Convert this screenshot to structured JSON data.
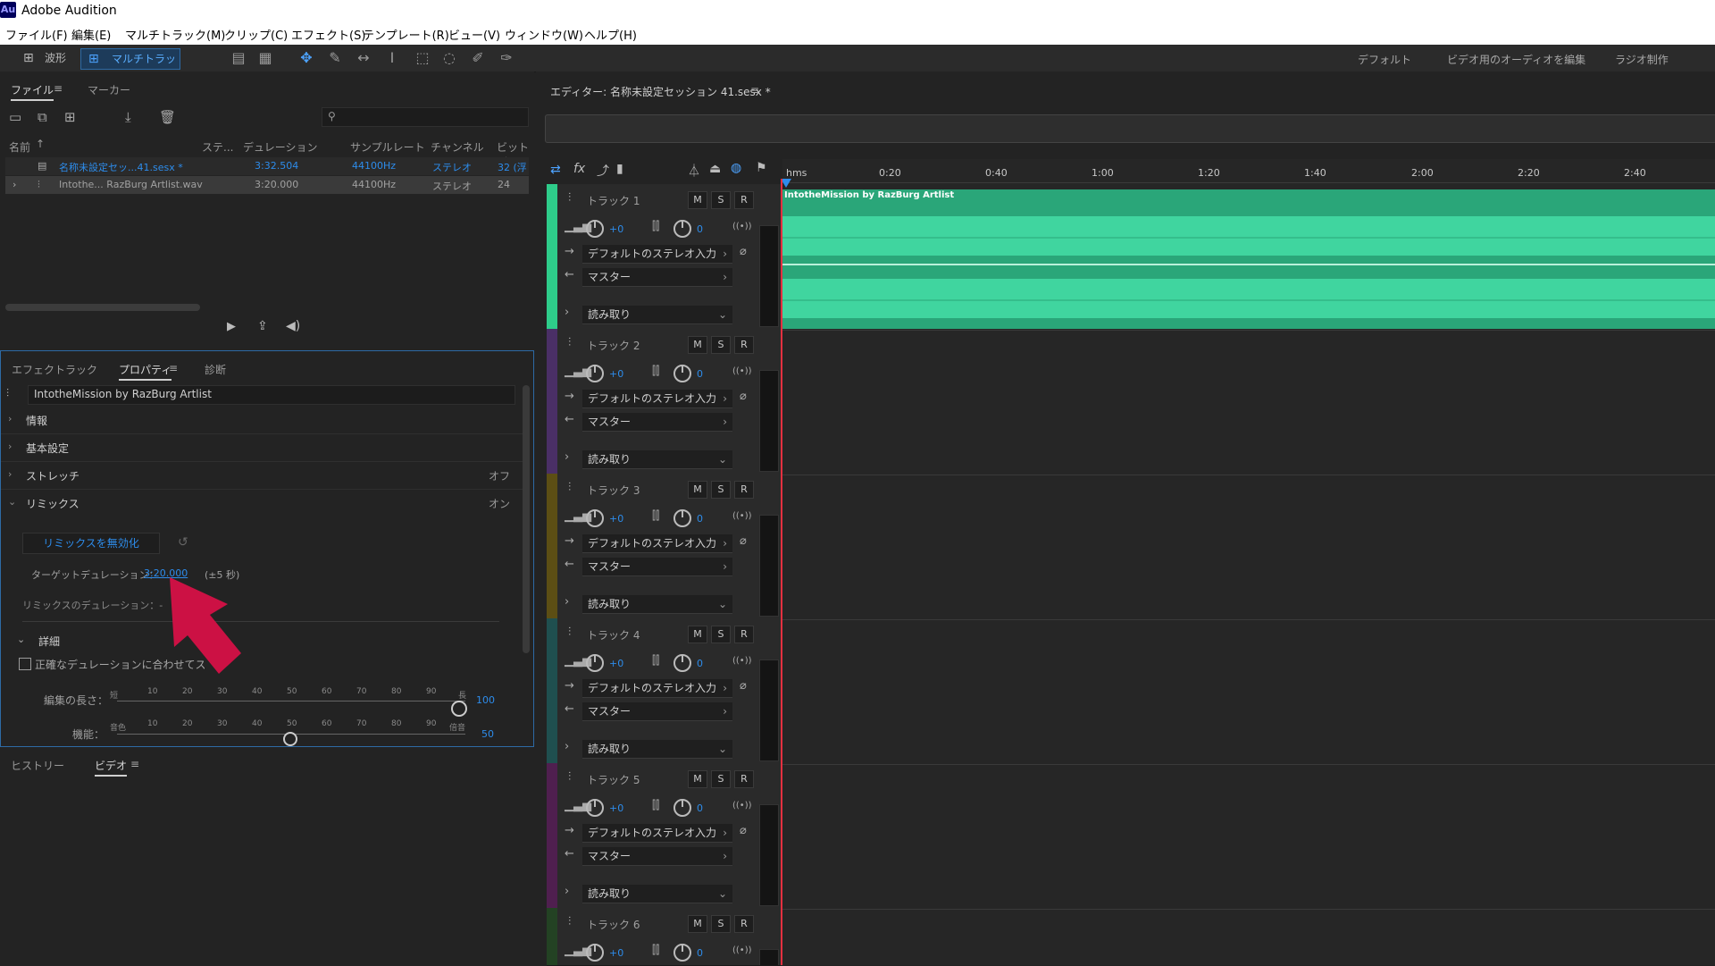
{
  "app": {
    "title": "Adobe Audition",
    "logo": "Au"
  },
  "menu": [
    "ファイル(F)",
    "編集(E)",
    "マルチトラック(M)",
    "クリップ(C)",
    "エフェクト(S)",
    "テンプレート(R)",
    "ビュー(V)",
    "ウィンドウ(W)",
    "ヘルプ(H)"
  ],
  "toolbar": {
    "waveform_label": "波形",
    "multitrack_label": "マルチトラック",
    "workspaces": [
      "デフォルト",
      "ビデオ用のオーディオを編集",
      "ラジオ制作"
    ]
  },
  "files_panel": {
    "tabs": [
      "ファイル",
      "マーカー"
    ],
    "search_placeholder": "",
    "columns": [
      "名前",
      "ステ...",
      "デュレーション",
      "サンプルレート",
      "チャンネル",
      "ビットデ"
    ],
    "rows": [
      {
        "name": "名称未設定セッ...41.sesx *",
        "duration": "3:32.504",
        "rate": "44100Hz",
        "channels": "ステレオ",
        "bits": "32 (浮"
      },
      {
        "name": "Intothe... RazBurg Artlist.wav",
        "duration": "3:20.000",
        "rate": "44100Hz",
        "channels": "ステレオ",
        "bits": "24"
      }
    ]
  },
  "props_panel": {
    "tabs": [
      "エフェクトラック",
      "プロパティ",
      "診断"
    ],
    "clip_name": "IntotheMission by RazBurg Artlist",
    "sections": [
      {
        "label": "情報",
        "value": ""
      },
      {
        "label": "基本設定",
        "value": ""
      },
      {
        "label": "ストレッチ",
        "value": "オフ"
      },
      {
        "label": "リミックス",
        "value": "オン"
      }
    ],
    "remix_button": "リミックスを無効化",
    "target_label": "ターゲットデュレーション：",
    "target_value": "3:20.000",
    "target_tolerance": "(±5 秒)",
    "remix_duration_label": "リミックスのデュレーション：-",
    "details_label": "詳細",
    "checkbox_label": "正確なデュレーションに合わせてストレッチ",
    "slider1": {
      "label": "編集の長さ：",
      "min_label": "短",
      "max_label": "長",
      "value": "100",
      "ticks": [
        "10",
        "20",
        "30",
        "40",
        "50",
        "60",
        "70",
        "80",
        "90"
      ]
    },
    "slider2": {
      "label": "機能：",
      "min_label": "音色",
      "max_label": "倍音",
      "value": "50",
      "ticks": [
        "10",
        "20",
        "30",
        "40",
        "50",
        "60",
        "70",
        "80",
        "90"
      ]
    }
  },
  "bottom_panel": {
    "tabs": [
      "ヒストリー",
      "ビデオ"
    ]
  },
  "editor": {
    "title": "エディター: 名称未設定セッション 41.sesx *",
    "ruler": [
      "hms",
      "0:20",
      "0:40",
      "1:00",
      "1:20",
      "1:40",
      "2:00",
      "2:20",
      "2:40"
    ],
    "clip_name": "IntotheMission by RazBurg Artlist",
    "track_common": {
      "input": "デフォルトのステレオ入力",
      "output": "マスター",
      "mode": "読み取り",
      "vol": "+0",
      "pan": "0",
      "m": "M",
      "s": "S",
      "r": "R"
    },
    "tracks": [
      {
        "name": "トラック 1",
        "color": "#2ecc8a"
      },
      {
        "name": "トラック 2",
        "color": "#5a3a7a"
      },
      {
        "name": "トラック 3",
        "color": "#6a5a1a"
      },
      {
        "name": "トラック 4",
        "color": "#2a5a5a"
      },
      {
        "name": "トラック 5",
        "color": "#5a2a5a"
      },
      {
        "name": "トラック 6",
        "color": "#2a4a2a"
      }
    ]
  },
  "colors": {
    "accent": "#2d8ceb",
    "wave": "#40d59f",
    "playhead": "#e33040",
    "arrow": "#cc1144"
  }
}
